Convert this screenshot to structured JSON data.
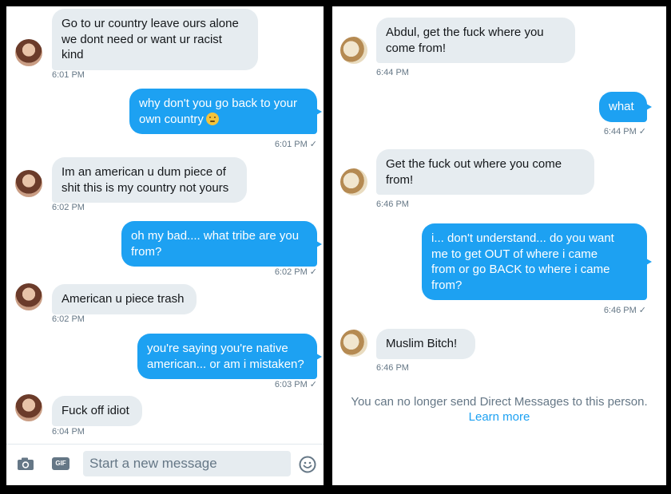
{
  "left": {
    "messages": [
      {
        "dir": "in",
        "lines": [
          "Go to ur country leave ours alone",
          "we dont need or want ur racist",
          "kind"
        ],
        "time": "6:01 PM"
      },
      {
        "dir": "out",
        "lines": [
          "why don't you go back to your",
          "own country"
        ],
        "emoji": "thinking-face",
        "time": "6:01 PM"
      },
      {
        "dir": "in",
        "lines": [
          "Im an american u dum piece of",
          "shit this is my country not yours"
        ],
        "time": "6:02 PM"
      },
      {
        "dir": "out",
        "lines": [
          "oh my bad.... what tribe are you",
          "from?"
        ],
        "time": "6:02 PM"
      },
      {
        "dir": "in",
        "lines": [
          "American u piece trash"
        ],
        "time": "6:02 PM"
      },
      {
        "dir": "out",
        "lines": [
          "you're saying you're native",
          "american... or am i mistaken?"
        ],
        "time": "6:03 PM"
      },
      {
        "dir": "in",
        "lines": [
          "Fuck off idiot"
        ],
        "time": "6:04 PM"
      }
    ],
    "composer": {
      "placeholder": "Start a new message",
      "gif_label": "GIF",
      "camera_icon": "camera-icon",
      "emoji_icon": "smiley-icon"
    }
  },
  "right": {
    "messages": [
      {
        "dir": "in",
        "lines": [
          "Abdul, get the fuck where you",
          "come from!"
        ],
        "time": "6:44 PM"
      },
      {
        "dir": "out",
        "lines": [
          "what"
        ],
        "time": "6:44 PM"
      },
      {
        "dir": "in",
        "lines": [
          "Get the fuck out where you come",
          "from!"
        ],
        "time": "6:46 PM"
      },
      {
        "dir": "out",
        "lines": [
          "i... don't understand... do you want",
          "me to get OUT of where i came",
          "from or go BACK to where i came",
          "from?"
        ],
        "time": "6:46 PM"
      },
      {
        "dir": "in",
        "lines": [
          "Muslim Bitch!"
        ],
        "time": "6:46 PM"
      }
    ],
    "notice": {
      "text": "You can no longer send Direct Messages to this person.",
      "link": "Learn more"
    }
  },
  "colors": {
    "outgoing": "#1da1f2",
    "incoming": "#e6ecf0",
    "timestamp": "#657786"
  },
  "read_mark": "✓"
}
